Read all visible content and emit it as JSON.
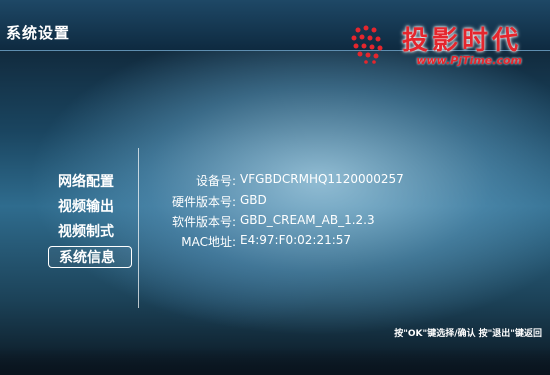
{
  "header": {
    "title": "系统设置"
  },
  "logo": {
    "brand": "投影时代",
    "url": "www.PjTime.com"
  },
  "menu": {
    "items": [
      {
        "label": "网络配置"
      },
      {
        "label": "视频输出"
      },
      {
        "label": "视频制式"
      },
      {
        "label": "系统信息",
        "selected": true
      }
    ]
  },
  "system_info": {
    "rows": [
      {
        "label": "设备号:",
        "value": "VFGBDCRMHQ1120000257"
      },
      {
        "label": "硬件版本号:",
        "value": "GBD"
      },
      {
        "label": "软件版本号:",
        "value": "GBD_CREAM_AB_1.2.3"
      },
      {
        "label": "MAC地址:",
        "value": "E4:97:F0:02:21:57"
      }
    ]
  },
  "footer": {
    "hint": "按\"OK\"键选择/确认 按\"退出\"键返回"
  },
  "colors": {
    "accent": "#e5262d",
    "header_bg": "#163650"
  }
}
